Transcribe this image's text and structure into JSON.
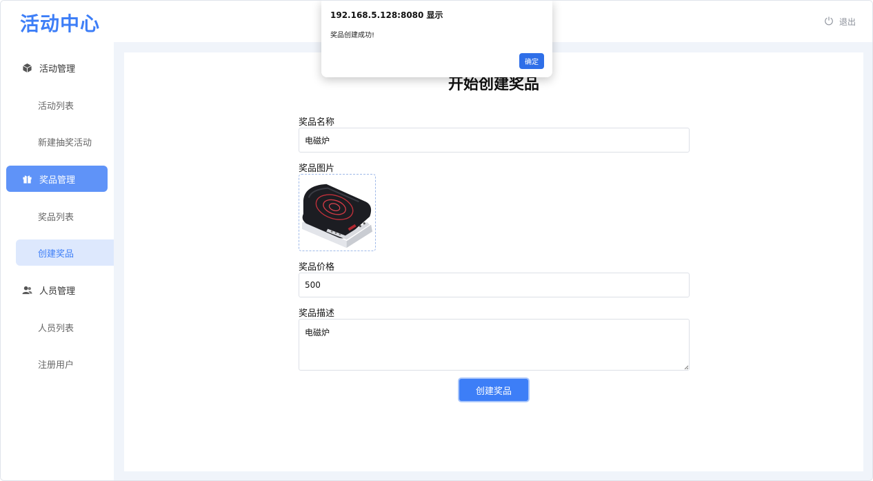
{
  "header": {
    "logo": "活动中心",
    "logout_label": "退出"
  },
  "sidebar": {
    "groups": [
      {
        "label": "活动管理",
        "icon": "cube-icon",
        "items": [
          "活动列表",
          "新建抽奖活动"
        ]
      },
      {
        "label": "奖品管理",
        "icon": "gift-icon",
        "items": [
          "奖品列表",
          "创建奖品"
        ]
      },
      {
        "label": "人员管理",
        "icon": "users-icon",
        "items": [
          "人员列表",
          "注册用户"
        ]
      }
    ],
    "active_group": "奖品管理",
    "active_item": "创建奖品"
  },
  "form": {
    "title": "开始创建奖品",
    "name_label": "奖品名称",
    "name_value": "电磁炉",
    "image_label": "奖品图片",
    "image_alt": "induction-cooker-image",
    "price_label": "奖品价格",
    "price_value": "500",
    "desc_label": "奖品描述",
    "desc_value": "电磁炉",
    "submit_label": "创建奖品"
  },
  "dialog": {
    "title": "192.168.5.128:8080 显示",
    "message": "奖品创建成功!",
    "ok_label": "确定"
  },
  "colors": {
    "accent": "#3d7ef7",
    "active_group_bg": "#5f93f8",
    "active_item_bg": "#dde8fd",
    "main_bg": "#f0f4fa"
  }
}
